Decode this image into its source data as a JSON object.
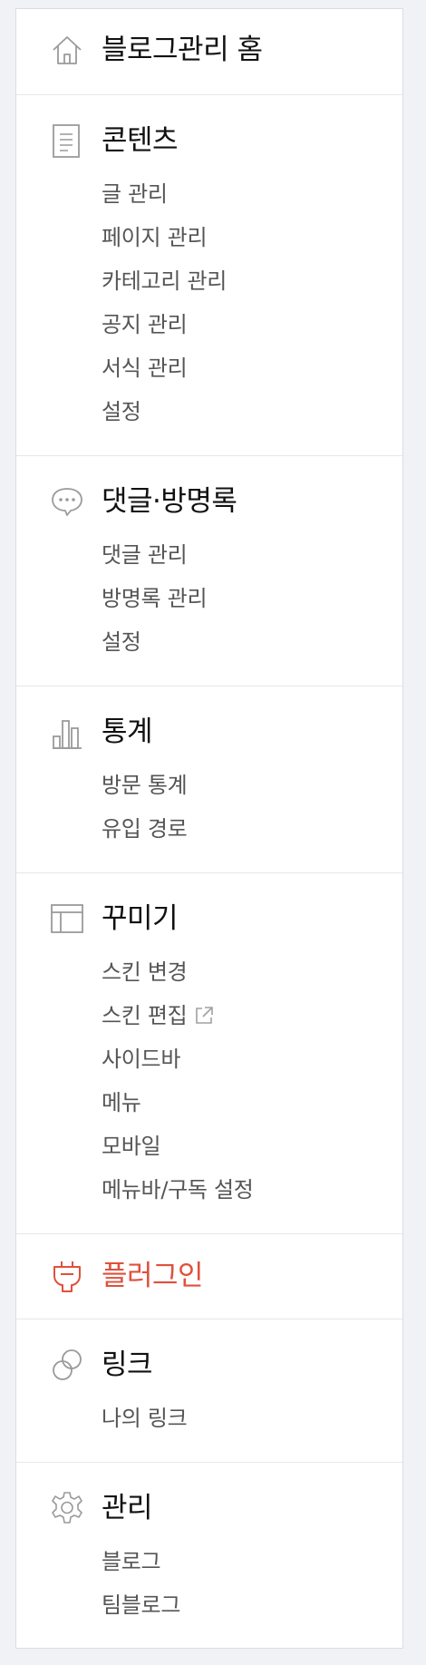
{
  "menu": {
    "home": {
      "title": "블로그관리 홈",
      "icon": "house-icon"
    },
    "content": {
      "title": "콘텐츠",
      "icon": "document-icon",
      "items": [
        "글 관리",
        "페이지 관리",
        "카테고리 관리",
        "공지 관리",
        "서식 관리",
        "설정"
      ]
    },
    "comments": {
      "title": "댓글·방명록",
      "icon": "speech-bubble-icon",
      "items": [
        "댓글 관리",
        "방명록 관리",
        "설정"
      ]
    },
    "stats": {
      "title": "통계",
      "icon": "bar-chart-icon",
      "items": [
        "방문 통계",
        "유입 경로"
      ]
    },
    "design": {
      "title": "꾸미기",
      "icon": "layout-icon",
      "items": [
        "스킨 변경",
        "스킨 편집",
        "사이드바",
        "메뉴",
        "모바일",
        "메뉴바/구독 설정"
      ],
      "external_icon": "external-link-icon"
    },
    "plugin": {
      "title": "플러그인",
      "icon": "plug-icon",
      "accent": "#e0503c"
    },
    "link": {
      "title": "링크",
      "icon": "link-icon",
      "items": [
        "나의 링크"
      ]
    },
    "manage": {
      "title": "관리",
      "icon": "gear-icon",
      "items": [
        "블로그",
        "팀블로그"
      ]
    }
  }
}
